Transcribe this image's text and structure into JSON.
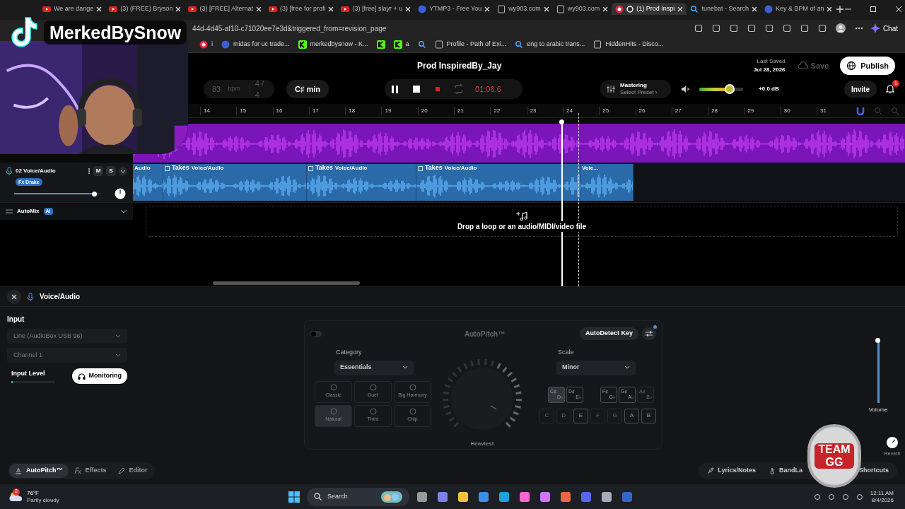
{
  "browser": {
    "tabs": [
      {
        "title": "We are dange",
        "kind": "youtube",
        "selected": false
      },
      {
        "title": "(3) (FREE) Bryson",
        "kind": "youtube",
        "selected": false
      },
      {
        "title": "(3) [FREE] Alternat",
        "kind": "youtube",
        "selected": false
      },
      {
        "title": "(3) [free for profi",
        "kind": "youtube",
        "selected": false
      },
      {
        "title": "(3) [free] slayr + u",
        "kind": "youtube",
        "selected": false
      },
      {
        "title": "YTMP3 - Free You",
        "kind": "site",
        "selected": false
      },
      {
        "title": "wy903.com",
        "kind": "page",
        "selected": false
      },
      {
        "title": "wy903.com",
        "kind": "page",
        "selected": false
      },
      {
        "title": "(1) Prod Inspi",
        "kind": "bandlab",
        "selected": true
      },
      {
        "title": "tunebat - Search",
        "kind": "search",
        "selected": false
      },
      {
        "title": "Key & BPM of an",
        "kind": "site",
        "selected": false
      }
    ],
    "address": "44d-4d45-af10-c71020ee7e3d&triggered_from=revision_page",
    "chat": "Chat",
    "bookmarks": [
      {
        "label": "i",
        "kind": "bandlab"
      },
      {
        "label": "midas for uc trade...",
        "kind": "site"
      },
      {
        "label": "merkedbysnow - K...",
        "kind": "kick"
      },
      {
        "kind": "kick"
      },
      {
        "label": "a",
        "kind": "kick"
      },
      {
        "kind": "search"
      },
      {
        "label": "Profile - Path of Exi...",
        "kind": "page"
      },
      {
        "label": "eng to arabic trans...",
        "kind": "search"
      },
      {
        "label": "HiddenHits - Disco...",
        "kind": "page"
      }
    ]
  },
  "overlay": {
    "channel_name": "MerkedBySnow",
    "coin_text": "TEAM GG"
  },
  "header": {
    "title": "Prod InspiredBy_Jay",
    "bpm": "83",
    "bpm_unit": "bpm",
    "meter": "4 / 4",
    "key": "C♯ min",
    "playing": true,
    "time": "01:06.6",
    "mastering": "Mastering",
    "preset": "Select Preset ›",
    "master_volume": {
      "level": 0.7
    },
    "gain": "+0.0 dB",
    "last_saved_label": "Last Saved",
    "last_saved": "Jul 28, 2026",
    "save": "Save",
    "publish": "Publish",
    "invite": "Invite",
    "notifications": "1"
  },
  "ruler": [
    "14",
    "15",
    "16",
    "17",
    "18",
    "19",
    "20",
    "21",
    "22",
    "23",
    "24",
    "25",
    "26",
    "27",
    "28",
    "29",
    "30",
    "31"
  ],
  "tracks": [
    {
      "name": "02 Voice/Audio",
      "mute": "M",
      "solo": "S",
      "effect": "Fx Drake",
      "volume": {
        "level": 0.93
      },
      "clips": [
        {
          "label": "Audio"
        },
        {
          "label": "Voice/Audio",
          "takes": "Takes"
        },
        {
          "label": "Voice/Audio",
          "takes": "Takes"
        },
        {
          "label": "Voice/Audio",
          "takes": "Takes"
        },
        {
          "label": "Voic..."
        }
      ]
    }
  ],
  "automix": {
    "label": "AutoMix",
    "badge": "AI"
  },
  "drop_hint": "Drop a loop or an audio/MIDI/video file",
  "panel": {
    "title": "Voice/Audio",
    "input_label": "Input",
    "input_device": "Line (AudioBox USB 96)",
    "channel": "Channel 1",
    "input_level_label": "Input Level",
    "monitoring": "Monitoring",
    "autopitch": {
      "title": "AutoPitch™",
      "enabled": false,
      "autodetect": "AutoDetect Key",
      "category_label": "Category",
      "category": "Essentials",
      "presets": [
        {
          "label": "Classic",
          "selected": false
        },
        {
          "label": "Duet",
          "selected": false
        },
        {
          "label": "Big Harmony",
          "selected": false
        },
        {
          "label": "Natural",
          "selected": true
        },
        {
          "label": "Third",
          "selected": false
        },
        {
          "label": "Chip",
          "selected": false
        }
      ],
      "knob_label": "Heaviest",
      "scale_label": "Scale",
      "scale": "Minor",
      "sharps": [
        {
          "top": "C♯",
          "bottom": "D♭",
          "in_scale": true,
          "root": true
        },
        {
          "top": "D♯",
          "bottom": "E♭",
          "in_scale": true,
          "root": false
        },
        {
          "top": "F♯",
          "bottom": "G♭",
          "in_scale": true,
          "root": false
        },
        {
          "top": "G♯",
          "bottom": "A♭",
          "in_scale": true,
          "root": false
        },
        {
          "top": "A♯",
          "bottom": "B♭",
          "in_scale": false,
          "root": false
        }
      ],
      "naturals": [
        {
          "label": "C",
          "in_scale": false
        },
        {
          "label": "D",
          "in_scale": false
        },
        {
          "label": "E",
          "in_scale": true
        },
        {
          "label": "F",
          "in_scale": false
        },
        {
          "label": "G",
          "in_scale": false
        },
        {
          "label": "A",
          "in_scale": true
        },
        {
          "label": "B",
          "in_scale": true
        }
      ]
    },
    "volume": {
      "label": "Volume",
      "level": 0.97
    },
    "reverb": "Reverb",
    "tabs": [
      {
        "label": "AutoPitch™",
        "selected": true
      },
      {
        "label": "Effects",
        "selected": false
      },
      {
        "label": "Editor",
        "selected": false
      }
    ],
    "tools": [
      "Lyrics/Notes",
      "BandLa",
      "Shortcuts"
    ]
  },
  "taskbar": {
    "temp": "76°F",
    "weather": "Partly cloudy",
    "weather_badge": "2",
    "search": "Search",
    "time": "12:11 AM",
    "date": "8/4/2026"
  }
}
